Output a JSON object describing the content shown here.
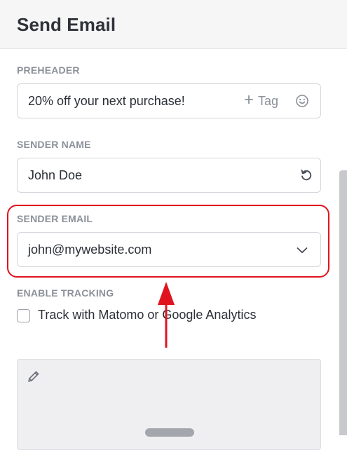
{
  "header": {
    "title": "Send Email"
  },
  "preheader": {
    "label": "PREHEADER",
    "value": "20% off your next purchase!",
    "tag_label": "Tag",
    "tag_icon": "plus-icon",
    "emoji_icon": "smiley-icon"
  },
  "sender_name": {
    "label": "SENDER NAME",
    "value": "John Doe",
    "reset_icon": "undo-icon"
  },
  "sender_email": {
    "label": "SENDER EMAIL",
    "value": "john@mywebsite.com",
    "dropdown_icon": "chevron-down-icon"
  },
  "tracking": {
    "label": "ENABLE TRACKING",
    "checkbox_label": "Track with Matomo or Google Analytics",
    "checked": false
  },
  "editor": {
    "edit_icon": "pencil-icon"
  },
  "annotation": {
    "highlight_color": "#e0141f",
    "arrow_color": "#e0141f"
  }
}
